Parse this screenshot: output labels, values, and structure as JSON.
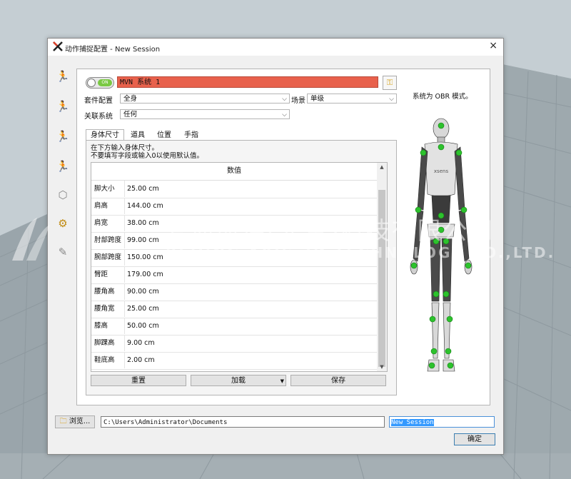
{
  "window": {
    "title": "动作捕捉配置 - New Session",
    "close_glyph": "×"
  },
  "system": {
    "toggle_label": "ON",
    "name": "MVN 系统 1",
    "status": "系统为 OBR 模式。"
  },
  "config": {
    "suit_label": "套件配置",
    "suit_value": "全身",
    "scene_label": "场景",
    "scene_value": "单级",
    "ref_label": "关联系统",
    "ref_value": "任何"
  },
  "tabs": [
    "身体尺寸",
    "道具",
    "位置",
    "手指"
  ],
  "hint": {
    "line1": "在下方输入身体尺寸。",
    "line2": "不要填写字段或输入0以使用默认值。"
  },
  "table": {
    "header": "数值",
    "rows": [
      {
        "name": "脚大小",
        "value": "25.00 cm"
      },
      {
        "name": "肩高",
        "value": "144.00 cm"
      },
      {
        "name": "肩宽",
        "value": "38.00 cm"
      },
      {
        "name": "肘部跨度",
        "value": "99.00 cm"
      },
      {
        "name": "腕部跨度",
        "value": "150.00 cm"
      },
      {
        "name": "臂距",
        "value": "179.00 cm"
      },
      {
        "name": "腰角高",
        "value": "90.00 cm"
      },
      {
        "name": "腰角宽",
        "value": "25.00 cm"
      },
      {
        "name": "膝高",
        "value": "50.00 cm"
      },
      {
        "name": "脚踝高",
        "value": "9.00 cm"
      },
      {
        "name": "鞋底高",
        "value": "2.00 cm"
      }
    ]
  },
  "buttons": {
    "reset": "重置",
    "load": "加载",
    "save": "保存",
    "browse": "浏览...",
    "ok": "确定"
  },
  "footer": {
    "path": "C:\\Users\\Administrator\\Documents",
    "session": "New Session"
  },
  "figure": {
    "brand": "xsens"
  },
  "watermark": {
    "cn": "爱迪斯通(北京)科技有限公司",
    "en": "BEIJING AXIS 3D TECHNOLOGY CO.,LTD."
  },
  "colors": {
    "system_bar": "#e8614c",
    "marker": "#2dc22d",
    "accent": "#3399ff"
  }
}
